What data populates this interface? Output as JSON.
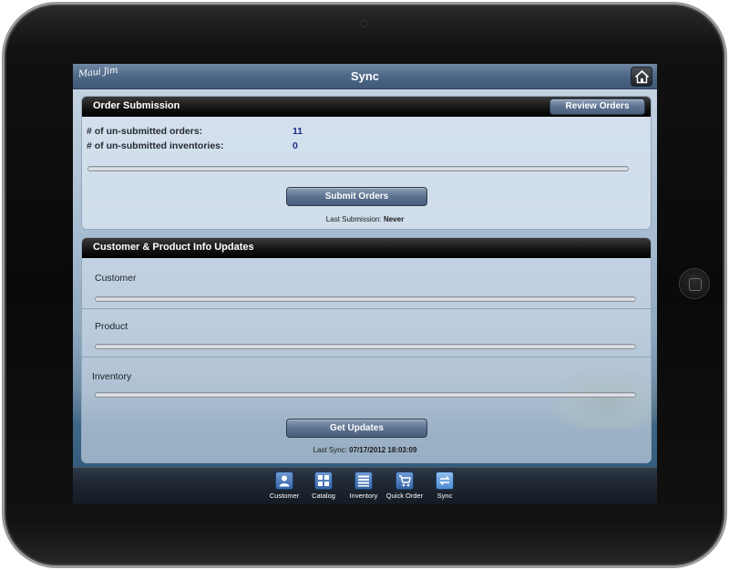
{
  "app": {
    "logo_text": "Maui Jim",
    "title": "Sync"
  },
  "order_submission": {
    "heading": "Order Submission",
    "review_label": "Review Orders",
    "rows": [
      {
        "label": "# of un-submitted orders:",
        "value": "11"
      },
      {
        "label": "# of un-submitted inventories:",
        "value": "0"
      }
    ],
    "progress": 0,
    "submit_label": "Submit Orders",
    "last_submission_label": "Last Submission:",
    "last_submission_value": "Never"
  },
  "updates": {
    "heading": "Customer & Product Info Updates",
    "sections": [
      {
        "label": "Customer",
        "progress": 0
      },
      {
        "label": "Product",
        "progress": 0
      },
      {
        "label": "Inventory",
        "progress": 0
      }
    ],
    "button_label": "Get Updates",
    "last_sync_label": "Last Sync:",
    "last_sync_value": "07/17/2012 18:03:09"
  },
  "tabbar": {
    "tabs": [
      {
        "label": "Customer",
        "icon": "person-icon"
      },
      {
        "label": "Catalog",
        "icon": "grid-icon"
      },
      {
        "label": "Inventory",
        "icon": "list-icon"
      },
      {
        "label": "Quick Order",
        "icon": "cart-icon"
      },
      {
        "label": "Sync",
        "icon": "sync-icon"
      }
    ],
    "active": "Sync"
  },
  "colors": {
    "value_text": "#1c2d8c",
    "header_bar": "#000000",
    "button": "#5d7290"
  }
}
